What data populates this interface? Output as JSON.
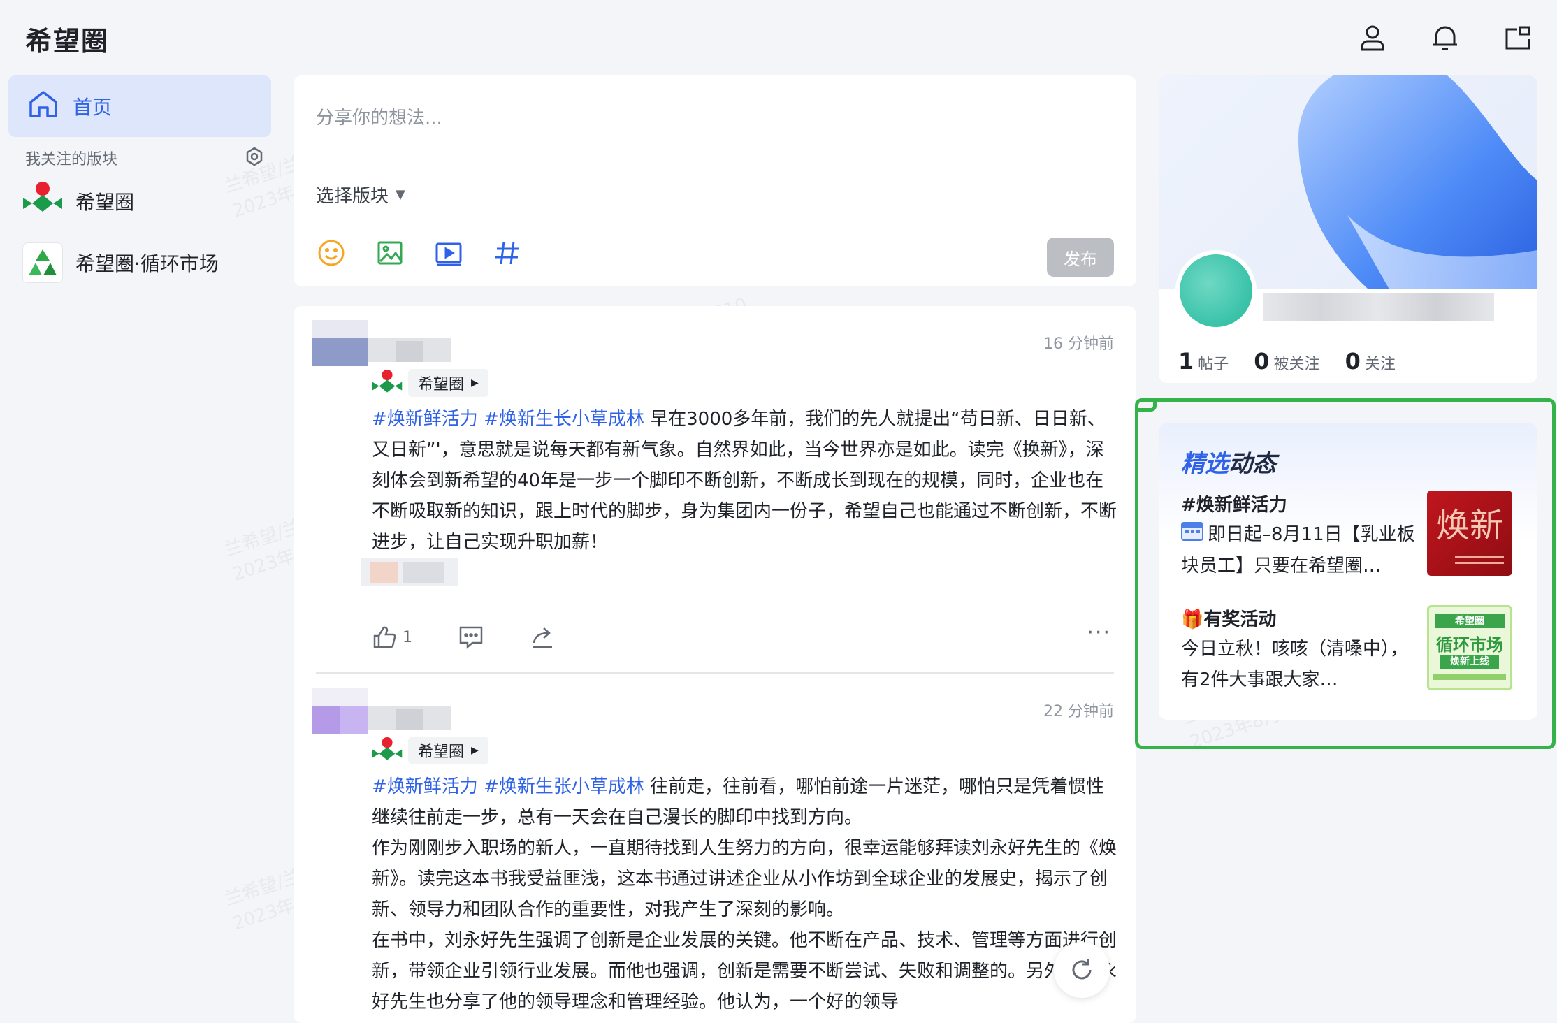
{
  "app": {
    "title": "希望圈"
  },
  "topbar": {
    "icons": [
      "user-icon",
      "bell-icon",
      "window-icon"
    ]
  },
  "sidebar": {
    "home_label": "首页",
    "section_label": "我关注的版块",
    "boards": [
      {
        "label": "希望圈",
        "icon": "xiwangquan-logo"
      },
      {
        "label": "希望圈·循环市场",
        "icon": "recycle-logo"
      }
    ]
  },
  "composer": {
    "placeholder": "分享你的想法...",
    "board_select": "选择版块",
    "tools": [
      "emoji-icon",
      "image-icon",
      "video-icon",
      "hashtag-icon"
    ],
    "publish": "发布"
  },
  "posts": [
    {
      "time": "16 分钟前",
      "board": "希望圈",
      "topics": [
        "#焕新鲜活力",
        "#焕新生长小草成林"
      ],
      "text": "早在3000多年前，我们的先人就提出“苟日新、日日新、又日新”'，意思就是说每天都有新气象。自然界如此，当今世界亦是如此。读完《换新》，深刻体会到新希望的40年是一步一个脚印不断创新，不断成长到现在的规模，同时，企业也在不断吸取新的知识，跟上时代的脚步，身为集团内一份子，希望自己也能通过不断创新，不断进步，让自己实现升职加薪！",
      "likes": "1"
    },
    {
      "time": "22 分钟前",
      "board": "希望圈",
      "topics": [
        "#焕新鲜活力",
        "#焕新生张小草成林"
      ],
      "paragraphs": [
        "往前走，往前看，哪怕前途一片迷茫，哪怕只是凭着惯性继续往前走一步，总有一天会在自己漫长的脚印中找到方向。",
        "作为刚刚步入职场的新人，一直期待找到人生努力的方向，很幸运能够拜读刘永好先生的《焕新》。读完这本书我受益匪浅，这本书通过讲述企业从小作坊到全球企业的发展史，揭示了创新、领导力和团队合作的重要性，对我产生了深刻的影响。",
        "在书中，刘永好先生强调了创新是企业发展的关键。他不断在产品、技术、管理等方面进行创新，带领企业引领行业发展。而他也强调，创新是需要不断尝试、失败和调整的。另外，刘永好先生也分享了他的领导理念和管理经验。他认为，一个好的领导"
      ]
    }
  ],
  "profile": {
    "stats": [
      {
        "value": "1",
        "label": "帖子"
      },
      {
        "value": "0",
        "label": "被关注"
      },
      {
        "value": "0",
        "label": "关注"
      }
    ]
  },
  "featured": {
    "title_a": "精选",
    "title_b": "动态",
    "items": [
      {
        "title": "#焕新鲜活力",
        "desc_icon": "calendar-icon",
        "desc": "即日起–8月11日【乳业板块员工】只要在希望圈…",
        "thumb_text": "焕新"
      },
      {
        "title": "有奖活动",
        "title_icon": "gift-icon",
        "desc": "今日立秋！咳咳（清嗓中），有2件大事跟大家…",
        "thumb_lines": [
          "希望圈",
          "循环市场",
          "焕新上线"
        ]
      }
    ]
  },
  "watermark": {
    "line1": "兰希望/兰芷馨-飞书 6710",
    "line2": "2023年8月10日 16:11"
  },
  "colors": {
    "accent": "#2f62e6",
    "highlight": "#35b34a"
  }
}
